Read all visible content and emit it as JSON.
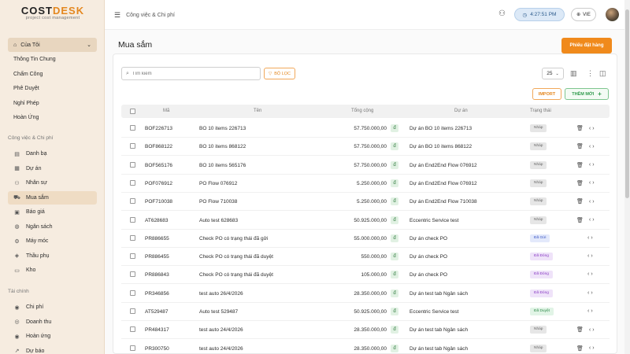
{
  "app": {
    "brand_left": "COST",
    "brand_right": "DESK",
    "tagline": "project cost management",
    "accent": "#e4871f"
  },
  "sidebar": {
    "group_toggle": "Của Tôi",
    "my_items": [
      {
        "label": "Thông Tin Chung"
      },
      {
        "label": "Chấm Công"
      },
      {
        "label": "Phê Duyệt"
      },
      {
        "label": "Nghỉ Phép"
      },
      {
        "label": "Hoàn Ứng"
      }
    ],
    "section_work": "Công việc & Chi phí",
    "work_items": [
      {
        "label": "Danh bạ",
        "icon": "contacts-icon"
      },
      {
        "label": "Dự án",
        "icon": "project-icon"
      },
      {
        "label": "Nhân sự",
        "icon": "people-icon"
      },
      {
        "label": "Mua sắm",
        "icon": "cart-icon",
        "active": true
      },
      {
        "label": "Báo giá",
        "icon": "quote-icon"
      },
      {
        "label": "Ngân sách",
        "icon": "budget-icon"
      },
      {
        "label": "Máy móc",
        "icon": "machine-icon"
      },
      {
        "label": "Thầu phụ",
        "icon": "subcontractor-icon"
      },
      {
        "label": "Kho",
        "icon": "warehouse-icon"
      }
    ],
    "section_finance": "Tài chính",
    "finance_items": [
      {
        "label": "Chi phí",
        "icon": "expense-icon"
      },
      {
        "label": "Doanh thu",
        "icon": "revenue-icon"
      },
      {
        "label": "Hoàn ứng",
        "icon": "advance-icon"
      },
      {
        "label": "Dự báo",
        "icon": "forecast-icon"
      }
    ]
  },
  "header": {
    "breadcrumb": "Công việc & Chi phí",
    "clock": "4:27:51 PM",
    "language": "VIE"
  },
  "page": {
    "title": "Mua sắm",
    "order_button": "Phiếu đặt hàng"
  },
  "toolbar": {
    "search_placeholder": "Tìm kiếm",
    "filter_label": "BỘ LỌC",
    "page_size": "25",
    "import_label": "IMPORT",
    "add_label": "THÊM MỚI"
  },
  "table": {
    "columns": [
      "Mã",
      "Tên",
      "Tổng cộng",
      "Dự án",
      "Trạng thái"
    ],
    "currency": "đ",
    "rows": [
      {
        "code": "BOF226713",
        "name": "BO 10 items 226713",
        "total": "57.750.000,00",
        "project": "Dự án BO 10 items 226713",
        "status": "Nháp",
        "tone": "gray",
        "delete": true
      },
      {
        "code": "BOF868122",
        "name": "BO 10 items 868122",
        "total": "57.750.000,00",
        "project": "Dự án BO 10 items 868122",
        "status": "Nháp",
        "tone": "gray",
        "delete": true
      },
      {
        "code": "BOF565176",
        "name": "BO 10 items 565176",
        "total": "57.750.000,00",
        "project": "Dự án End2End Flow 076912",
        "status": "Nháp",
        "tone": "gray",
        "delete": true
      },
      {
        "code": "POF076912",
        "name": "PO Flow 076912",
        "total": "5.250.000,00",
        "project": "Dự án End2End Flow 076912",
        "status": "Nháp",
        "tone": "gray",
        "delete": true
      },
      {
        "code": "POF710038",
        "name": "PO Flow 710038",
        "total": "5.250.000,00",
        "project": "Dự án End2End Flow 710038",
        "status": "Nháp",
        "tone": "gray",
        "delete": true
      },
      {
        "code": "AT628683",
        "name": "Auto test 628683",
        "total": "50.925.000,00",
        "project": "Eccentric Service test",
        "status": "Nháp",
        "tone": "gray",
        "delete": true
      },
      {
        "code": "PR886655",
        "name": "Check PO có trạng thái đã gửi",
        "total": "55.000.000,00",
        "project": "Dự án check PO",
        "status": "Đã Gửi",
        "tone": "blue",
        "delete": false
      },
      {
        "code": "PR886455",
        "name": "Check PO có trạng thái đã duyệt",
        "total": "550.000,00",
        "project": "Dự án check PO",
        "status": "Đã Đóng",
        "tone": "purple",
        "delete": false
      },
      {
        "code": "PR886843",
        "name": "Check PO có trạng thái đã duyệt",
        "total": "105.000,00",
        "project": "Dự án check PO",
        "status": "Đã Đóng",
        "tone": "purple",
        "delete": false
      },
      {
        "code": "PR346856",
        "name": "test auto 26/4/2026",
        "total": "28.350.000,00",
        "project": "Dự án test tab Ngân sách",
        "status": "Đã Đóng",
        "tone": "purple",
        "delete": false
      },
      {
        "code": "AT529487",
        "name": "Auto test 529487",
        "total": "50.925.000,00",
        "project": "Eccentric Service test",
        "status": "Đã Duyệt",
        "tone": "green",
        "delete": false
      },
      {
        "code": "PR484317",
        "name": "test auto 24/4/2026",
        "total": "28.350.000,00",
        "project": "Dự án test tab Ngân sách",
        "status": "Nháp",
        "tone": "gray",
        "delete": true
      },
      {
        "code": "PR300750",
        "name": "test auto 24/4/2026",
        "total": "28.350.000,00",
        "project": "Dự án test tab Ngân sách",
        "status": "Nháp",
        "tone": "gray",
        "delete": true
      }
    ]
  }
}
